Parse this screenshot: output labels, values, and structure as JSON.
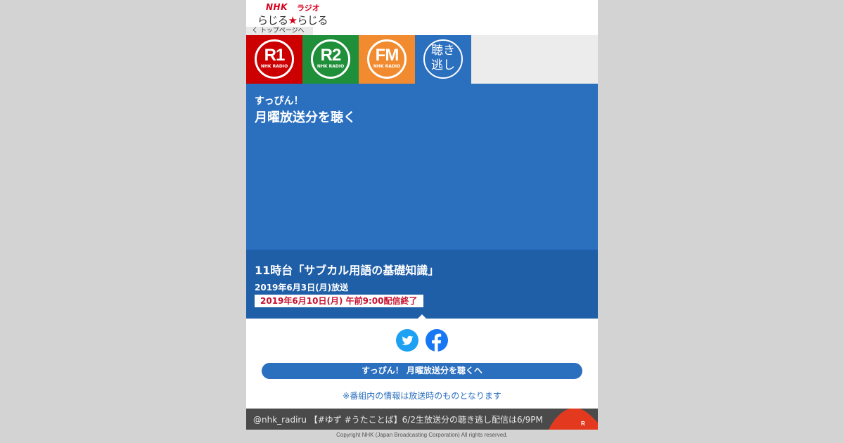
{
  "header": {
    "logo_brand": "NHK",
    "logo_radio": "ラジオ",
    "logo_rajiru_left": "らじる",
    "logo_star": "★",
    "logo_rajiru_right": "らじる",
    "back_link": "く トップページへ"
  },
  "tabs": [
    {
      "id": "r1",
      "big": "R1",
      "small": "NHK RADIO",
      "color": "#cc0000"
    },
    {
      "id": "r2",
      "big": "R2",
      "small": "NHK RADIO",
      "color": "#1f8f3a"
    },
    {
      "id": "fm",
      "big": "FM",
      "small": "NHK RADIO",
      "color": "#f28b30"
    },
    {
      "id": "kiki",
      "line1": "聴き",
      "line2": "逃し",
      "color": "#2b6fbf"
    }
  ],
  "hero": {
    "program_name": "すっぴん！",
    "title": "月曜放送分を聴く"
  },
  "episode": {
    "title": "11時台「サブカル用語の基礎知識」",
    "broadcast_date": "2019年6月3日(月)放送",
    "expiry": "2019年6月10日(月) 午前9:00配信終了"
  },
  "lower": {
    "twitter_icon": "twitter-icon",
    "facebook_icon": "facebook-icon",
    "listen_button": "すっぴん！ 月曜放送分を聴くへ",
    "info_note": "※番組内の情報は放送時のものとなります"
  },
  "ticker": {
    "text": "@nhk_radiru 【#ゆず #うたことば】6/2生放送分の聴き逃し配信は6/9PM"
  },
  "footer": {
    "copyright": "Copyright NHK (Japan Broadcasting Corporation) All rights reserved."
  },
  "colors": {
    "primary_blue": "#2b6fbf",
    "dark_blue": "#1f5fa8",
    "r1_red": "#cc0000",
    "r2_green": "#1f8f3a",
    "fm_orange": "#f28b30",
    "expiry_red": "#c8102e"
  }
}
